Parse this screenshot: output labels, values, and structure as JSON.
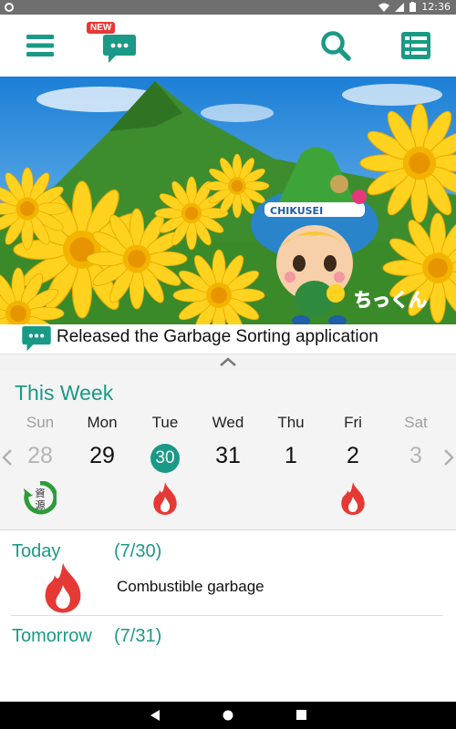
{
  "status_bar": {
    "time": "12:36"
  },
  "header": {
    "new_badge": "NEW"
  },
  "announcement": {
    "text": "Released the  Garbage Sorting application"
  },
  "hero": {
    "mascot_label": "CHIKUSEI",
    "mascot_name": "ちっくん"
  },
  "week": {
    "title": "This Week",
    "days": [
      {
        "name": "Sun",
        "date": "28",
        "dim": true,
        "icon": "recycle-resources-icon"
      },
      {
        "name": "Mon",
        "date": "29",
        "dim": false,
        "icon": ""
      },
      {
        "name": "Tue",
        "date": "30",
        "dim": false,
        "today": true,
        "icon": "fire-icon"
      },
      {
        "name": "Wed",
        "date": "31",
        "dim": false,
        "icon": ""
      },
      {
        "name": "Thu",
        "date": "1",
        "dim": false,
        "icon": ""
      },
      {
        "name": "Fri",
        "date": "2",
        "dim": false,
        "icon": "fire-icon"
      },
      {
        "name": "Sat",
        "date": "3",
        "dim": true,
        "icon": ""
      }
    ],
    "recycle_glyph": "資源"
  },
  "today": {
    "label": "Today",
    "date": "(7/30)",
    "garbage": "Combustible garbage"
  },
  "tomorrow": {
    "label": "Tomorrow",
    "date": "(7/31)"
  },
  "colors": {
    "accent": "#1a9a86",
    "fire": "#e53935",
    "recycle": "#2e9b3a"
  }
}
